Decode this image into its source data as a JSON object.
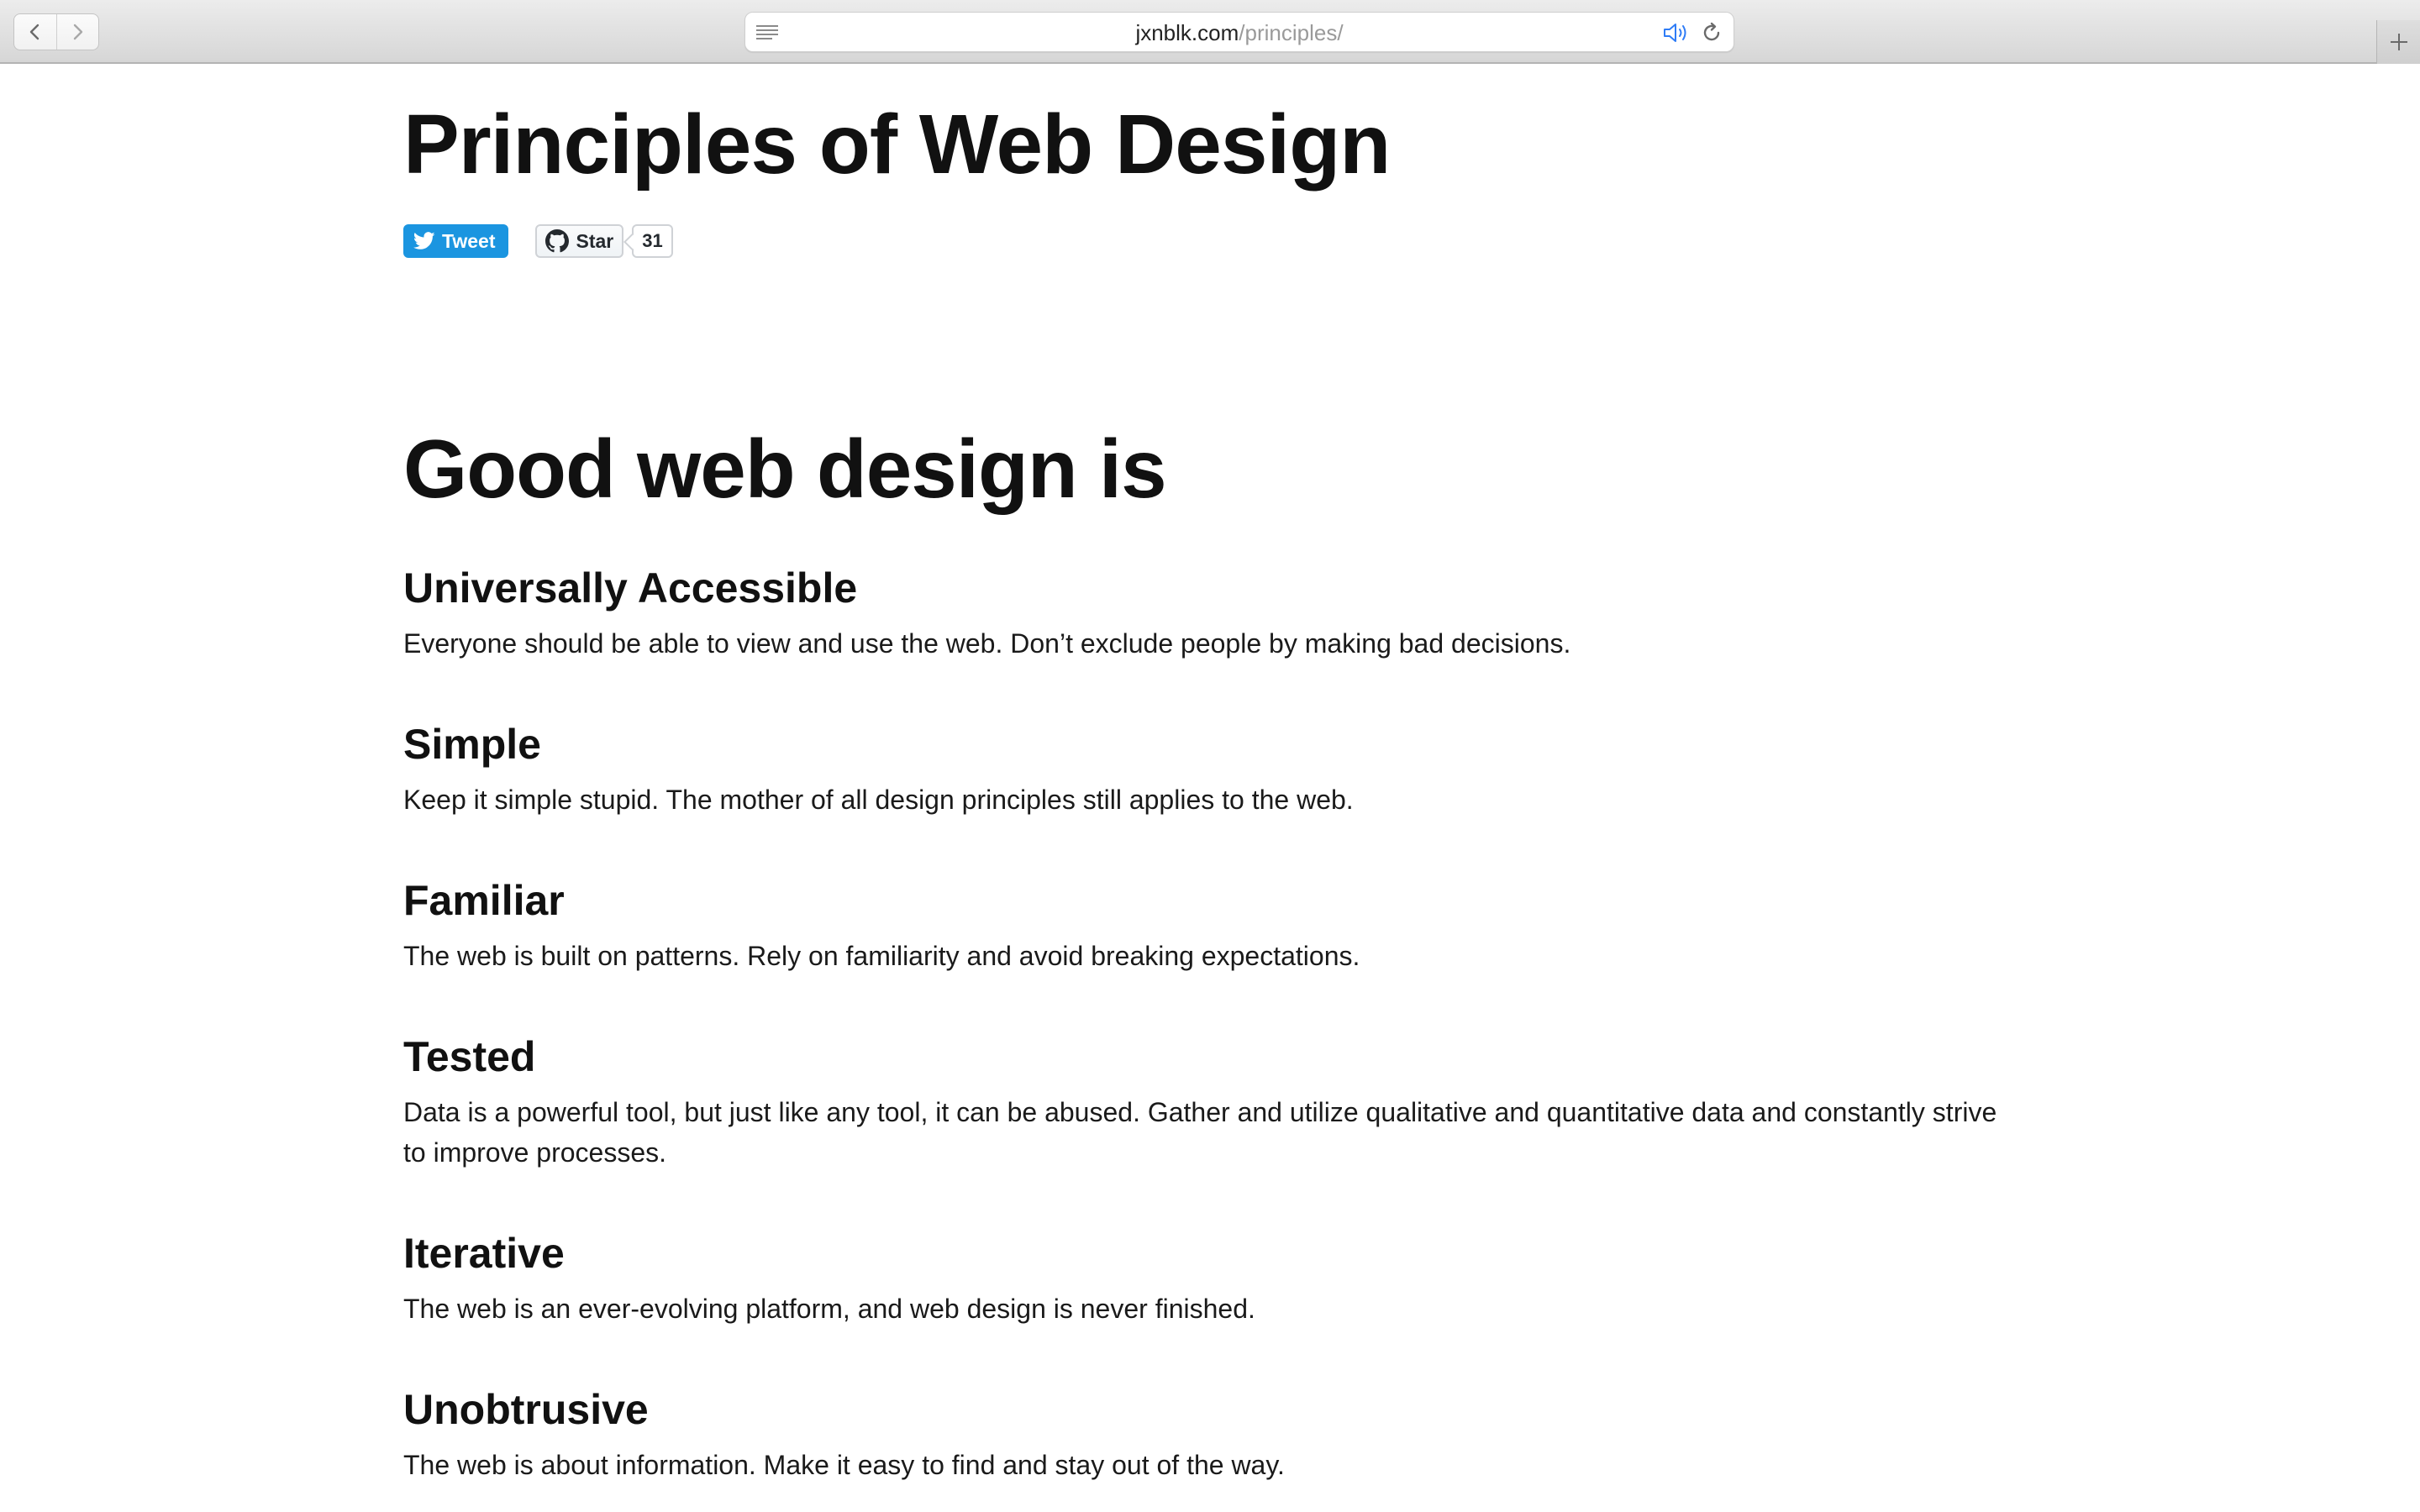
{
  "browser": {
    "url_host": "jxnblk.com",
    "url_path": "/principles/",
    "icons": {
      "back": "chevron-left-icon",
      "forward": "chevron-right-icon",
      "reader": "reader-lines-icon",
      "audio": "speaker-icon",
      "reload": "reload-icon",
      "new_tab": "plus-icon"
    }
  },
  "page": {
    "title": "Principles of Web Design",
    "tweet_label": "Tweet",
    "star_label": "Star",
    "star_count": "31",
    "section_title": "Good web design is",
    "principles": [
      {
        "title": "Universally Accessible",
        "text": "Everyone should be able to view and use the web. Don’t exclude people by making bad decisions."
      },
      {
        "title": "Simple",
        "text": "Keep it simple stupid. The mother of all design principles still applies to the web."
      },
      {
        "title": "Familiar",
        "text": "The web is built on patterns. Rely on familiarity and avoid breaking expectations."
      },
      {
        "title": "Tested",
        "text": "Data is a powerful tool, but just like any tool, it can be abused. Gather and utilize qualitative and quantitative data and constantly strive to improve processes."
      },
      {
        "title": "Iterative",
        "text": "The web is an ever-evolving platform, and web design is never finished."
      },
      {
        "title": "Unobtrusive",
        "text": "The web is about information. Make it easy to find and stay out of the way."
      }
    ]
  },
  "colors": {
    "tweet_blue": "#1b95e0",
    "text": "#111111",
    "audio_blue": "#2f7cf6"
  }
}
